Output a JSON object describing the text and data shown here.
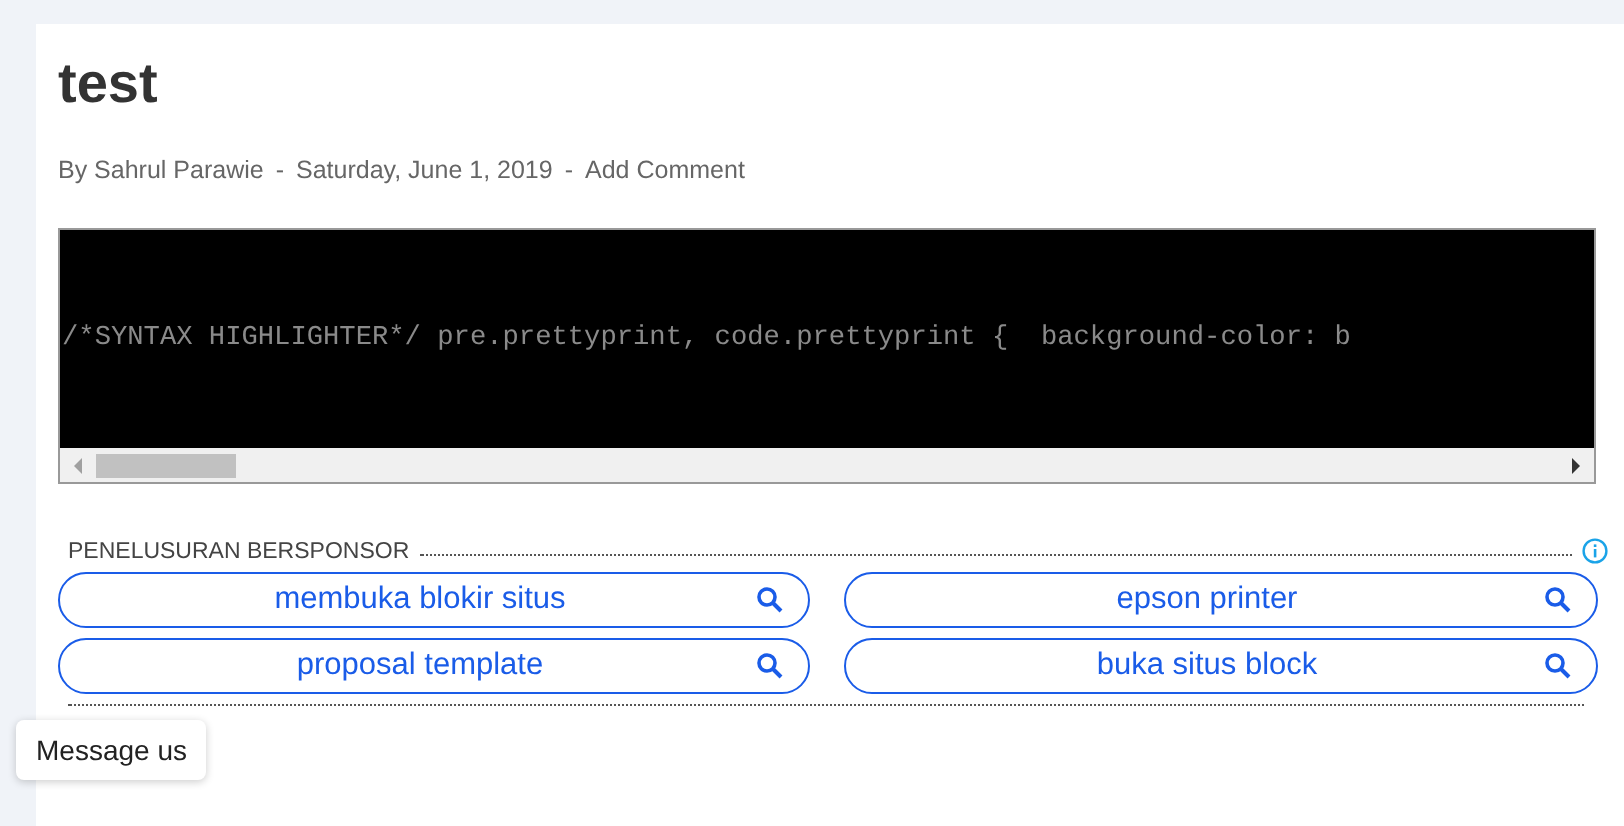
{
  "post": {
    "title": "test",
    "author": "By Sahrul Parawie",
    "date": "Saturday, June 1, 2019",
    "comments": "Add Comment",
    "separator": "-"
  },
  "code": {
    "text": "/*SYNTAX HIGHLIGHTER*/ pre.prettyprint, code.prettyprint {  background-color: b"
  },
  "sponsored": {
    "label": "PENELUSURAN BERSPONSOR",
    "searches": [
      {
        "label": "membuka blokir situs"
      },
      {
        "label": "epson printer"
      },
      {
        "label": "proposal template"
      },
      {
        "label": "buka situs block"
      }
    ]
  },
  "chat": {
    "label": "Message us"
  }
}
